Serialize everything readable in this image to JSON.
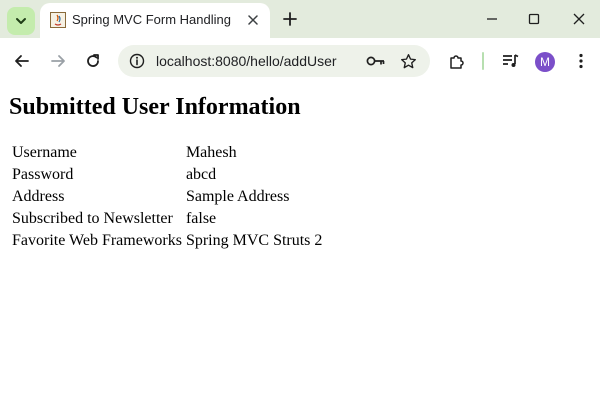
{
  "browser": {
    "tab": {
      "title": "Spring MVC Form Handling"
    },
    "address_bar": {
      "url": "localhost:8080/hello/addUser"
    },
    "profile": {
      "initial": "M",
      "color": "#7b4fc9"
    }
  },
  "page": {
    "title": "Submitted User Information",
    "rows": [
      {
        "label": "Username",
        "value": "Mahesh"
      },
      {
        "label": "Password",
        "value": "abcd"
      },
      {
        "label": "Address",
        "value": "Sample Address"
      },
      {
        "label": "Subscribed to Newsletter",
        "value": "false"
      },
      {
        "label": "Favorite Web Frameworks",
        "value": "Spring MVC Struts 2"
      }
    ]
  }
}
